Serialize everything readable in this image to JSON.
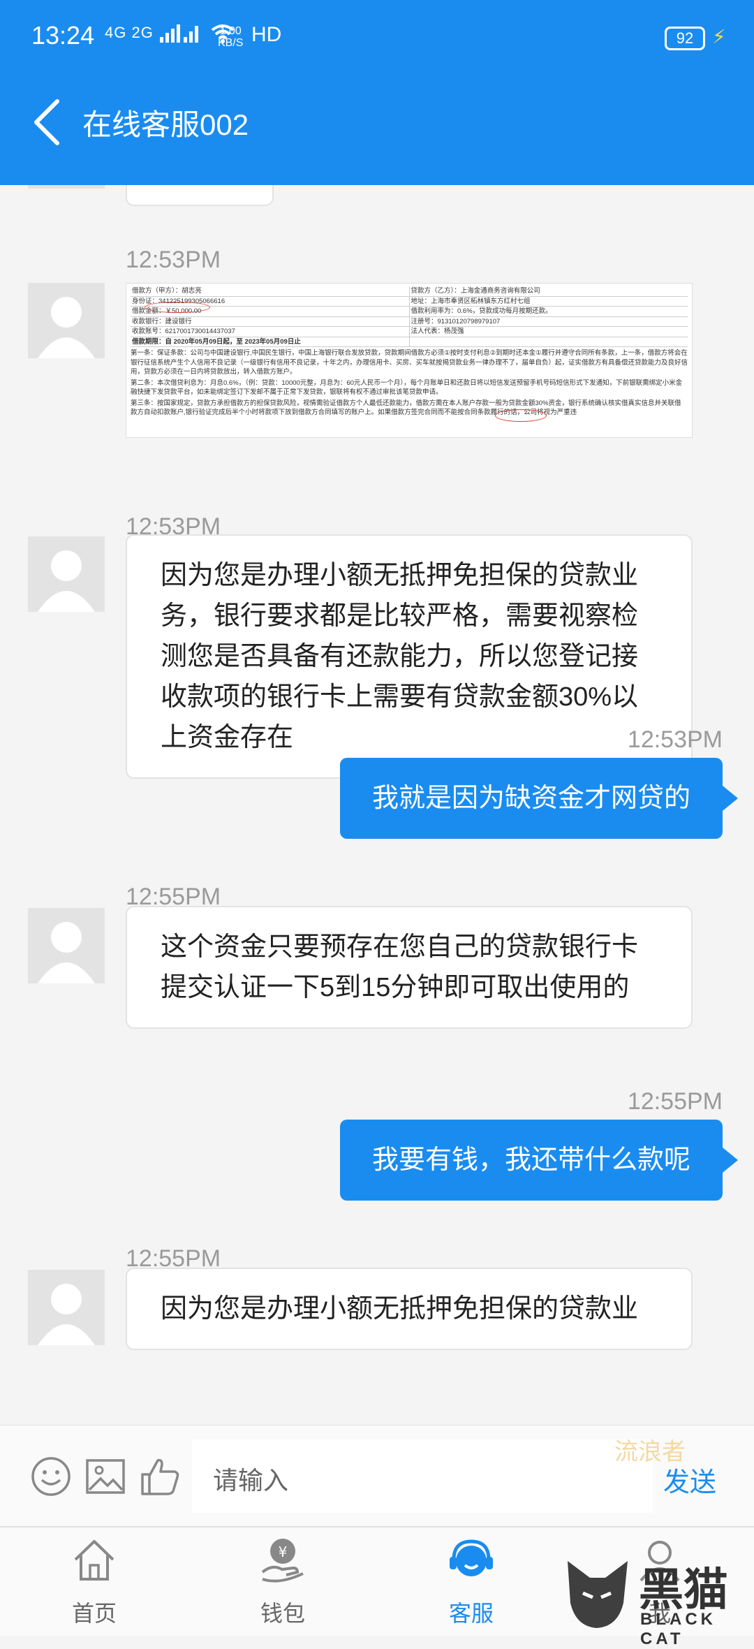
{
  "status_bar": {
    "time": "13:24",
    "network": "4G 2G",
    "speed_value": "1.00",
    "speed_unit": "KB/S",
    "hd": "HD",
    "battery": "92"
  },
  "header": {
    "title": "在线客服002"
  },
  "messages": [
    {
      "time": "12:53PM",
      "side": "in",
      "type": "image"
    },
    {
      "time": "12:53PM",
      "side": "in",
      "text": "因为您是办理小额无抵押免担保的贷款业务，银行要求都是比较严格，需要视察检测您是否具备有还款能力，所以您登记接收款项的银行卡上需要有贷款金额30%以上资金存在"
    },
    {
      "time": "12:53PM",
      "side": "out",
      "text": "我就是因为缺资金才网贷的"
    },
    {
      "time": "12:55PM",
      "side": "in",
      "text": "这个资金只要预存在您自己的贷款银行卡提交认证一下5到15分钟即可取出使用的"
    },
    {
      "time": "12:55PM",
      "side": "out",
      "text": "我要有钱，我还带什么款呢"
    },
    {
      "time": "12:55PM",
      "side": "in",
      "text": "因为您是办理小额无抵押免担保的贷款业"
    }
  ],
  "document": {
    "rows": [
      [
        "借款方（甲方）：胡志亮",
        "贷款方（乙方）：上海金通商务咨询有限公司"
      ],
      [
        "身份证：341225199305066616",
        "地址：上海市奉贤区柘林镇东方红村七组"
      ],
      [
        "借款金额：￥50,000.00",
        "借款利用率为：0.6%，贷款成功每月按期还款。"
      ],
      [
        "收款银行：建设银行",
        "注册号：91310120798979107"
      ],
      [
        "收款账号：6217001730014437037",
        "法人代表：杨茂强"
      ],
      [
        "借款期限：自 2020年05月09日起，至 2023年05月09日止",
        ""
      ]
    ],
    "paragraphs": [
      "第一条：保证条款：公司与中国建设银行,中国民生银行，中国上海银行联合发放贷款，贷款期间借款方必须①按时支付利息②到期时还本金①履行并遵守合同所有条款，上一条，借款方将会在银行征信系统产生个人信用不良记录（一级银行有信用不良记录，十年之内，办理信用卡、买房、买车就按揭贷款业务一律办理不了，届单自负）起，证实借款方有具备偿还贷款能力及良好信用，贷款方必须在一日内将贷款放出，转入借款方账户。",
      "第二条：本次借贷利息为：月息0.6%，（例：贷款：10000元整，月息为：60元人民币一个月），每个月账单日和还款日将以短信发送预留手机号码短信形式下发通知，下前银联需绑定小米金融快捷下发贷款平台，如未能绑定签订下发邮不属于正常下发贷款，银联将有权不通过审批该笔贷款申请。",
      "第三条：按国家规定，贷款方承担借款方的担保贷款风险，视情需验证借款方个人最低还款能力，借款方需在本人账户存款一般为贷款金额30%资金，银行系统确认核实借真实信息并关联借款方自动扣款账户,银行验证完成后半个小时将款项下放到借款方合同填写的账户上。如果借款方签完合同而不能按合同条款履行的话，公司将视为严重违"
    ]
  },
  "input": {
    "placeholder": "请输入",
    "send": "发送",
    "watermark": "流浪者"
  },
  "nav": [
    {
      "label": "首页"
    },
    {
      "label": "钱包"
    },
    {
      "label": "客服"
    },
    {
      "label": "我"
    }
  ],
  "logo": {
    "cn": "黑猫",
    "en": "BLACK CAT"
  },
  "colors": {
    "accent": "#1a8cf0",
    "background": "#f4f4f4"
  }
}
